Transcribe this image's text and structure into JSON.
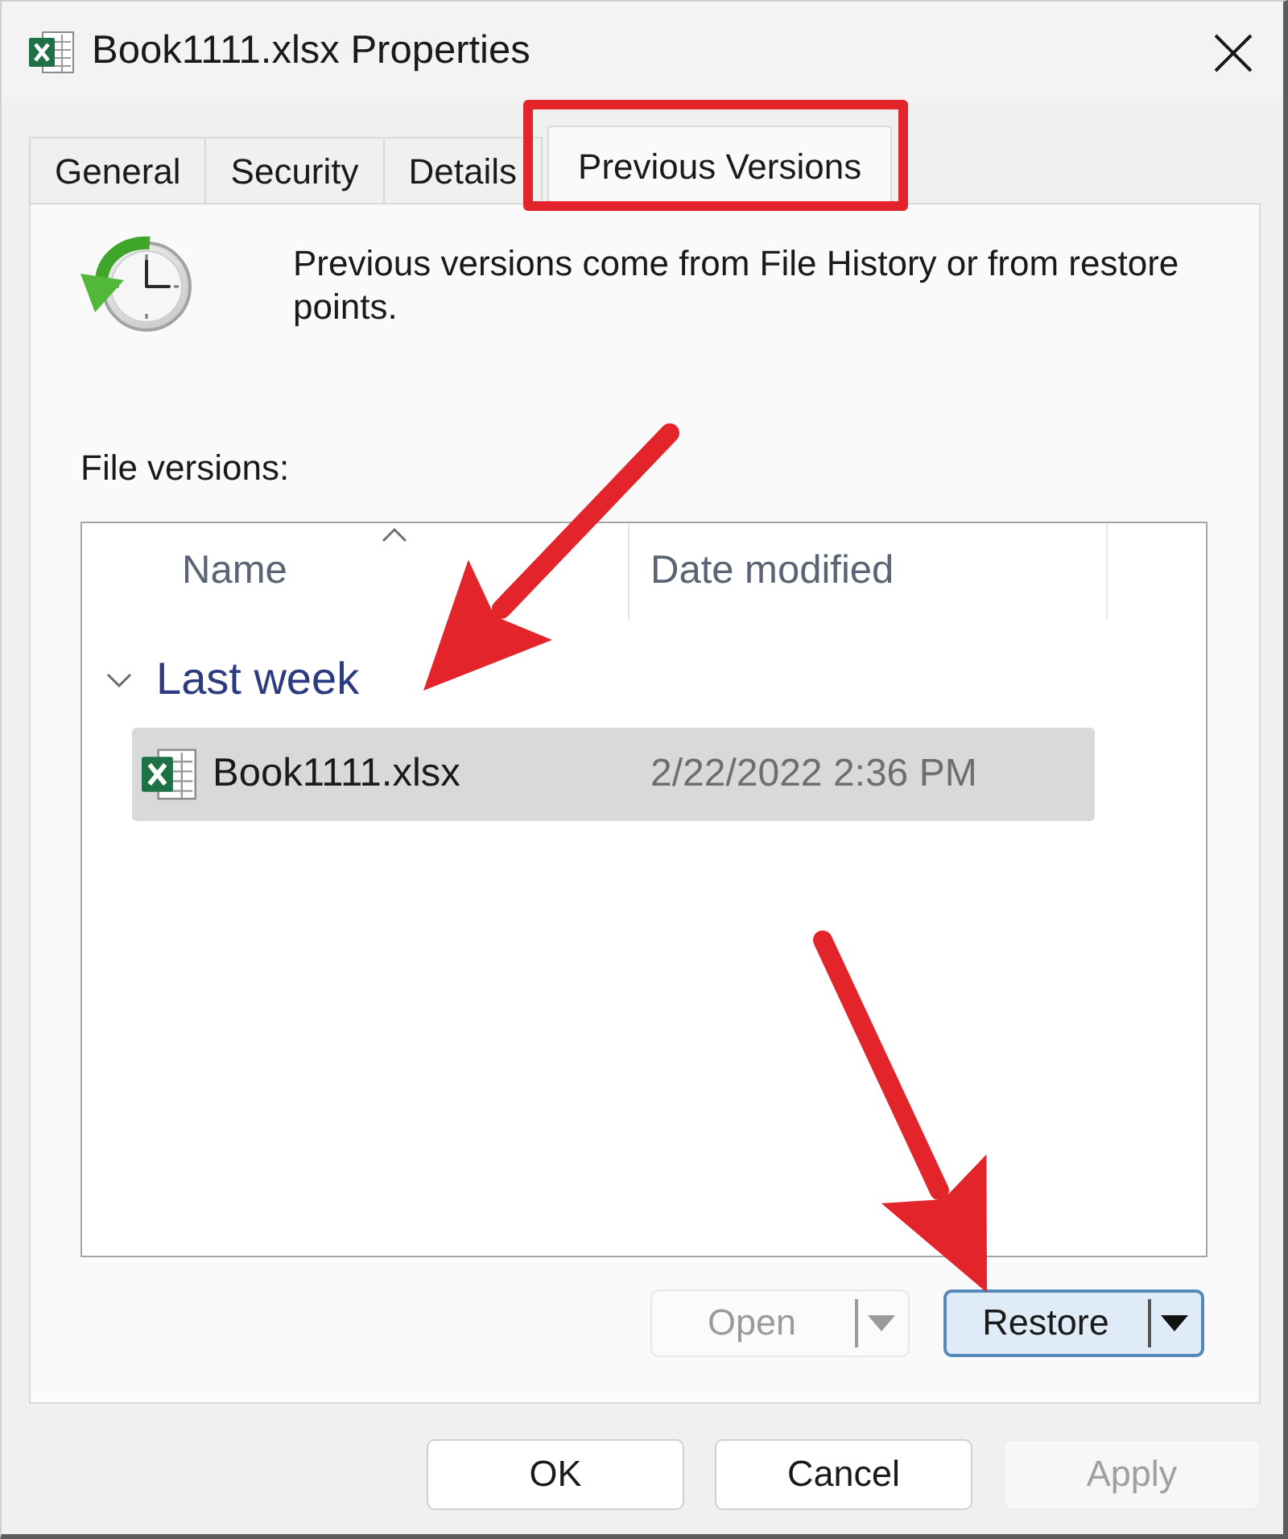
{
  "window": {
    "title": "Book1111.xlsx Properties"
  },
  "tabs": [
    {
      "label": "General",
      "selected": false,
      "highlighted": false
    },
    {
      "label": "Security",
      "selected": false,
      "highlighted": false
    },
    {
      "label": "Details",
      "selected": false,
      "highlighted": false
    },
    {
      "label": "Previous Versions",
      "selected": true,
      "highlighted": true
    }
  ],
  "intro": "Previous versions come from File History or from restore points.",
  "file_versions": {
    "label": "File versions:",
    "columns": [
      {
        "label": "Name",
        "sorted": true
      },
      {
        "label": "Date modified",
        "sorted": false
      }
    ],
    "groups": [
      {
        "label": "Last week",
        "expanded": true,
        "rows": [
          {
            "name": "Book1111.xlsx",
            "date_modified": "2/22/2022 2:36 PM",
            "selected": true
          }
        ]
      }
    ]
  },
  "actions": [
    {
      "label": "Open",
      "disabled": true,
      "focused": false
    },
    {
      "label": "Restore",
      "disabled": false,
      "focused": true
    }
  ],
  "buttons": [
    {
      "label": "OK",
      "disabled": false
    },
    {
      "label": "Cancel",
      "disabled": false
    },
    {
      "label": "Apply",
      "disabled": true
    }
  ],
  "callouts": [
    {
      "kind": "arrow"
    },
    {
      "kind": "arrow"
    }
  ]
}
